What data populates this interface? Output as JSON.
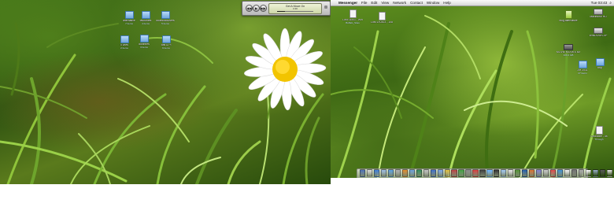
{
  "menubar": {
    "apple": "",
    "app_name": "Messenger",
    "menus": [
      "File",
      "Edit",
      "View",
      "Network",
      "Contact",
      "Window",
      "Help"
    ],
    "clock": "Tue 03:43",
    "spotlight": "⌕"
  },
  "itunes": {
    "prev": "◀◀",
    "play": "▶",
    "next": "▶▶",
    "track": "Get A Move On",
    "time": "0:36",
    "progress": 0.22
  },
  "left_icons": [
    {
      "label": "alternative",
      "sub": "7 items",
      "icon": "folder-icon"
    },
    {
      "label": "favourites",
      "sub": "4 items",
      "icon": "folder-icon"
    },
    {
      "label": "downloadUsers",
      "sub": "5 items",
      "icon": "folder-icon"
    },
    {
      "label": "iTunes",
      "sub": "2 items",
      "icon": "folder-icon"
    },
    {
      "label": "doctrines",
      "sub": "3 items",
      "icon": "folder-icon"
    },
    {
      "label": "Bits & Pi",
      "sub": "9 items",
      "icon": "folder-icon"
    }
  ],
  "right_icons": [
    {
      "label": "Lost 01x01 - Win",
      "sub": "Buffalo_Sites",
      "icon": "document-icon"
    },
    {
      "label": "Lost 1X0303 - 108",
      "sub": "",
      "icon": "document-icon"
    },
    {
      "label": "blog.alternative",
      "sub": "",
      "icon": "document-green-icon"
    },
    {
      "label": "Macintosh HD",
      "sub": "",
      "icon": "hard-drive-icon"
    },
    {
      "label": "WINDOWS-XP",
      "sub": "",
      "icon": "hard-drive-icon"
    },
    {
      "label": "MOVIE MOVIES BACK",
      "sub": "109.4 GB",
      "icon": "external-drive-icon"
    },
    {
      "label": "AH 2011",
      "sub": "27 items",
      "icon": "folder-icon"
    },
    {
      "label": "tmp",
      "sub": "",
      "icon": "folder-icon"
    },
    {
      "label": "Crocodile - 08",
      "sub": "Through",
      "icon": "document-icon"
    }
  ],
  "dock_colors": [
    "#4a6fb5",
    "#d9d9d9",
    "#3b7dd8",
    "#9bbbe0",
    "#5aa0e0",
    "#b0b0b0",
    "#e08a2a",
    "#6aa0d8",
    "#2e8b57",
    "#c0c0c0",
    "#3c6ec8",
    "#7aa7e8",
    "#e0c040",
    "#b84040",
    "#40a040",
    "#8a8a8a",
    "#d83c3c",
    "#3a3a3a",
    "#6fb7ff",
    "#2d2d2d",
    "#a0c8f0",
    "#e6e6e6",
    "#4f8f2f",
    "#1e5aa8",
    "#d87030",
    "#8080d0",
    "#c8c8c8",
    "#e04848",
    "#4090d0",
    "#f0f0f0",
    "#707070",
    "#a8a8a8",
    "#ffffff",
    "#9ab0c8",
    "#5a5a5a",
    "#e8e8e8",
    "#b0b0d0",
    "#6a8fc8"
  ]
}
